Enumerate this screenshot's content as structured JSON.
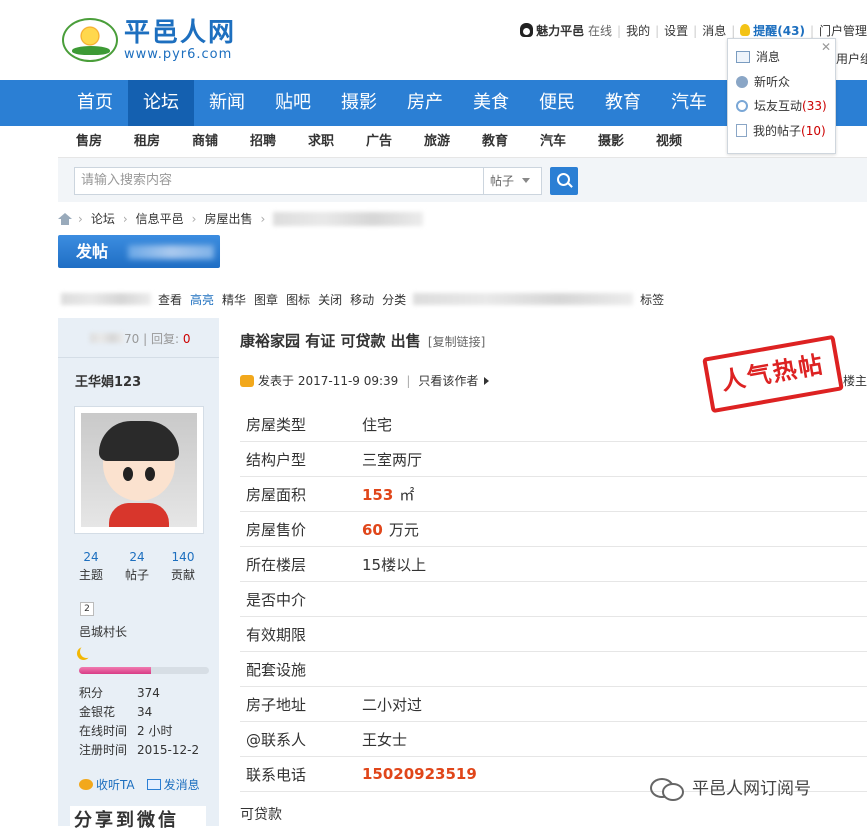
{
  "logo": {
    "name": "平邑人网",
    "url": "www.pyr6.com"
  },
  "topnav": {
    "user": "魅力平邑",
    "status": "在线",
    "mine": "我的",
    "settings": "设置",
    "messages": "消息",
    "remind": "提醒(43)",
    "portal": "门户管理",
    "partial": "用户组"
  },
  "popup": {
    "items": [
      {
        "label": "消息",
        "count": ""
      },
      {
        "label": "新听众",
        "count": ""
      },
      {
        "label": "坛友互动",
        "count": "(33)"
      },
      {
        "label": "我的帖子",
        "count": "(10)"
      }
    ]
  },
  "nav": [
    "首页",
    "论坛",
    "新闻",
    "贴吧",
    "摄影",
    "房产",
    "美食",
    "便民",
    "教育",
    "汽车"
  ],
  "subnav": [
    "售房",
    "租房",
    "商铺",
    "招聘",
    "求职",
    "广告",
    "旅游",
    "教育",
    "汽车",
    "摄影",
    "视频"
  ],
  "search": {
    "placeholder": "请输入搜索内容",
    "type": "帖子"
  },
  "breadcrumb": [
    "论坛",
    "信息平邑",
    "房屋出售"
  ],
  "post_button": "发帖",
  "tabs": [
    "查看",
    "高亮",
    "精华",
    "图章",
    "图标",
    "关闭",
    "移动",
    "分类",
    "标签"
  ],
  "sidebar": {
    "replies_label": "回复:",
    "replies": "0",
    "partial_views": "70",
    "username": "王华娟123",
    "stats": [
      {
        "num": "24",
        "label": "主题"
      },
      {
        "num": "24",
        "label": "帖子"
      },
      {
        "num": "140",
        "label": "贡献"
      }
    ],
    "level_badge": "2",
    "rank": "邑城村长",
    "progress": 0.55,
    "info": [
      {
        "k": "积分",
        "v": "374"
      },
      {
        "k": "金银花",
        "v": "34"
      },
      {
        "k": "在线时间",
        "v": "2 小时"
      },
      {
        "k": "注册时间",
        "v": "2015-12-2"
      }
    ],
    "listen": "收听TA",
    "send_msg": "发消息",
    "share": "分享到微信"
  },
  "post": {
    "title": "康裕家园 有证 可贷款 出售",
    "copy_link": "[复制链接]",
    "posted_at": "发表于 2017-11-9 09:39",
    "only_author": "只看该作者",
    "floor": "楼主",
    "stamp": "人气热帖",
    "rows": [
      {
        "k": "房屋类型",
        "v": "住宅",
        "unit": ""
      },
      {
        "k": "结构户型",
        "v": "三室两厅",
        "unit": ""
      },
      {
        "k": "房屋面积",
        "v": "153",
        "unit": "㎡"
      },
      {
        "k": "房屋售价",
        "v": "60",
        "unit": "万元"
      },
      {
        "k": "所在楼层",
        "v": "15楼以上",
        "unit": ""
      },
      {
        "k": "是否中介",
        "v": "",
        "unit": ""
      },
      {
        "k": "有效期限",
        "v": "",
        "unit": ""
      },
      {
        "k": "配套设施",
        "v": "",
        "unit": ""
      },
      {
        "k": "房子地址",
        "v": "二小对过",
        "unit": ""
      },
      {
        "k": "@联系人",
        "v": "王女士",
        "unit": ""
      },
      {
        "k": "联系电话",
        "v": "15020923519",
        "unit": ""
      }
    ],
    "body": "可贷款"
  },
  "watermark": "平邑人网订阅号",
  "colors": {
    "primary": "#2b7fd4",
    "highlight": "#e0461a",
    "stamp": "#dd2222"
  }
}
